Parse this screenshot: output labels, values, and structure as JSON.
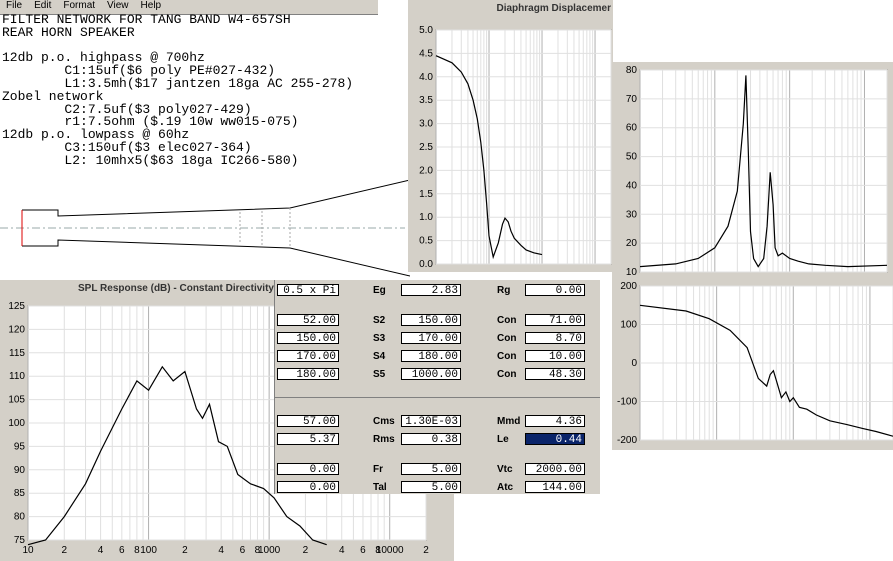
{
  "menu": [
    "File",
    "Edit",
    "Format",
    "View",
    "Help"
  ],
  "notes": [
    "FILTER NETWORK FOR TANG BAND W4-657SH",
    "REAR HORN SPEAKER",
    "",
    "12db p.o. highpass @ 700hz",
    "        C1:15uf($6 poly PE#027-432)",
    "        L1:3.5mh($17 jantzen 18ga AC 255-278)",
    "Zobel network",
    "        C2:7.5uf($3 poly027-429)",
    "        r1:7.5ohm ($.19 10w ww015-075)",
    "12db p.o. lowpass @ 60hz",
    "        C3:150uf($3 elec027-364)",
    "        L2: 10mhx5($63 18ga IC266-580)"
  ],
  "diaphragm_title": "Diaphragm Displacemer",
  "spl_title": "SPL Response (dB) - Constant Directivity - He",
  "params": {
    "top": {
      "value": "0.5 x Pi",
      "eg_label": "Eg",
      "eg": "2.83",
      "rg_label": "Rg",
      "rg": "0.00"
    },
    "rows": [
      {
        "left": "52.00",
        "label": "S2",
        "mid": "150.00",
        "con": "Con",
        "right": "71.00"
      },
      {
        "left": "150.00",
        "label": "S3",
        "mid": "170.00",
        "con": "Con",
        "right": "8.70"
      },
      {
        "left": "170.00",
        "label": "S4",
        "mid": "180.00",
        "con": "Con",
        "right": "10.00"
      },
      {
        "left": "180.00",
        "label": "S5",
        "mid": "1000.00",
        "con": "Con",
        "right": "48.30"
      }
    ],
    "mid_rows": [
      {
        "left": "57.00",
        "label": "Cms",
        "mid": "1.30E-03",
        "lab2": "Mmd",
        "right": "4.36",
        "sel": false
      },
      {
        "left": "5.37",
        "label": "Rms",
        "mid": "0.38",
        "lab2": "Le",
        "right": "0.44",
        "sel": true
      }
    ],
    "bot_rows": [
      {
        "left": "0.00",
        "label": "Fr",
        "mid": "5.00",
        "lab2": "Vtc",
        "right": "2000.00"
      },
      {
        "left": "0.00",
        "label": "Tal",
        "mid": "5.00",
        "lab2": "Atc",
        "right": "144.00"
      }
    ]
  },
  "chart_data": [
    {
      "type": "line",
      "title": "Diaphragm Displacemer",
      "ylim": [
        0,
        5
      ],
      "yticks": [
        "5.0",
        "4.5",
        "4.0",
        "3.5",
        "3.0",
        "2.5",
        "2.0",
        "1.5",
        "1.0",
        "0.5",
        "0.0"
      ],
      "x_scale": "log",
      "xlim": [
        10,
        20000
      ],
      "series": [
        {
          "x": [
            10,
            20,
            30,
            40,
            50,
            60,
            70,
            80,
            90,
            100,
            120,
            150,
            180,
            200,
            230,
            260,
            300,
            400,
            500,
            700,
            1000
          ],
          "values": [
            4.45,
            4.3,
            4.1,
            3.85,
            3.5,
            3.1,
            2.6,
            2.0,
            1.3,
            0.6,
            0.15,
            0.45,
            0.85,
            0.98,
            0.9,
            0.7,
            0.55,
            0.4,
            0.3,
            0.24,
            0.2
          ]
        }
      ]
    },
    {
      "type": "line",
      "title": "",
      "ylim": [
        5,
        80
      ],
      "yticks": [
        "80",
        "70",
        "60",
        "50",
        "40",
        "30",
        "20",
        "10"
      ],
      "x_scale": "log",
      "xlim": [
        10,
        20000
      ],
      "series": [
        {
          "x": [
            10,
            30,
            60,
            100,
            150,
            200,
            240,
            260,
            280,
            300,
            330,
            380,
            450,
            500,
            550,
            600,
            640,
            700,
            800,
            1000,
            1300,
            1800,
            3000,
            6000,
            20000
          ],
          "values": [
            7,
            8,
            10,
            14,
            22,
            35,
            60,
            78,
            50,
            20,
            10,
            7,
            10,
            22,
            42,
            30,
            14,
            11,
            12,
            10,
            9,
            8,
            7.5,
            7,
            7.5
          ]
        }
      ]
    },
    {
      "type": "line",
      "title": "",
      "ylim": [
        -200,
        200
      ],
      "yticks": [
        "200",
        "100",
        "0",
        "-100",
        "-200"
      ],
      "x_scale": "log",
      "xlim": [
        10,
        20000
      ],
      "series": [
        {
          "x": [
            10,
            40,
            80,
            150,
            250,
            350,
            450,
            500,
            550,
            600,
            700,
            800,
            900,
            1000,
            1200,
            1500,
            2000,
            3000,
            5000,
            8000,
            12000,
            20000
          ],
          "values": [
            150,
            135,
            115,
            85,
            40,
            -40,
            -60,
            -30,
            -20,
            -45,
            -90,
            -75,
            -100,
            -90,
            -115,
            -120,
            -135,
            -150,
            -160,
            -170,
            -178,
            -190
          ]
        }
      ]
    },
    {
      "type": "line",
      "title": "SPL Response (dB) - Constant Directivity - He",
      "ylim": [
        75,
        125
      ],
      "yticks": [
        "125",
        "120",
        "115",
        "110",
        "105",
        "100",
        "95",
        "90",
        "85",
        "80",
        "75"
      ],
      "x_scale": "log",
      "xlim": [
        10,
        20000
      ],
      "xticks": [
        "10",
        "2",
        "4",
        "6",
        "8",
        "100",
        "2",
        "4",
        "6",
        "8",
        "1000",
        "2",
        "4",
        "6",
        "8",
        "10000",
        "2"
      ],
      "series": [
        {
          "x": [
            10,
            14,
            20,
            30,
            40,
            60,
            80,
            100,
            130,
            160,
            200,
            250,
            280,
            320,
            380,
            450,
            550,
            700,
            900,
            1100,
            1400,
            1800,
            2300,
            3000
          ],
          "values": [
            70,
            75,
            80,
            87,
            94,
            103,
            109,
            107,
            112,
            109,
            111,
            103,
            101,
            104,
            96,
            95,
            89,
            87,
            86,
            84,
            80,
            78,
            75,
            72
          ]
        }
      ]
    }
  ]
}
